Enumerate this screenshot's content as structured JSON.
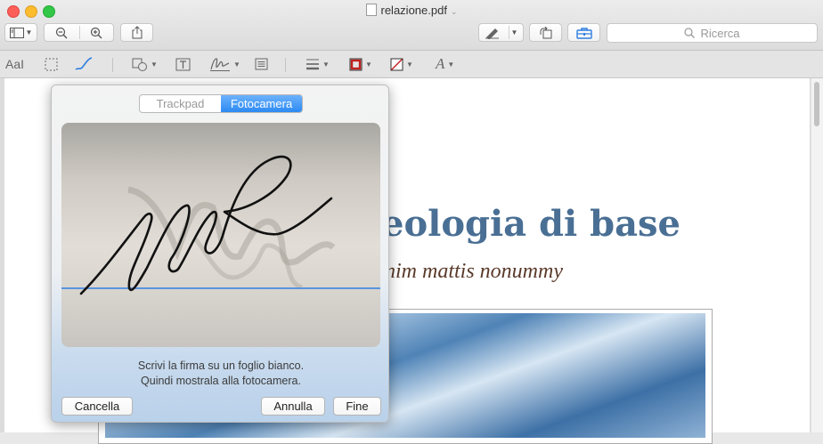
{
  "window": {
    "title": "relazione.pdf"
  },
  "toolbar": {
    "search_placeholder": "Ricerca"
  },
  "markup": {
    "text_style_label": "AaI"
  },
  "document": {
    "heading_partial": "eologia di base",
    "subheading_partial": "nim mattis nonummy"
  },
  "signature_popover": {
    "tabs": [
      {
        "label": "Trackpad",
        "selected": false
      },
      {
        "label": "Fotocamera",
        "selected": true
      }
    ],
    "instruction_line1": "Scrivi la firma su un foglio bianco.",
    "instruction_line2": "Quindi mostrala alla fotocamera.",
    "clear_label": "Cancella",
    "cancel_label": "Annulla",
    "done_label": "Fine"
  },
  "colors": {
    "accent": "#2d8af3",
    "heading": "#4a6f94",
    "subheading": "#5a3a2a",
    "border_color_swatch": "#c0211f",
    "baseline": "#5a95de"
  },
  "icons": [
    "sidebar-icon",
    "zoom-out-icon",
    "zoom-in-icon",
    "share-icon",
    "markup-pen-icon",
    "rotate-icon",
    "toolbox-icon",
    "search-icon",
    "rect-selection-icon",
    "sketch-icon",
    "shapes-icon",
    "text-box-icon",
    "signature-icon",
    "note-icon",
    "line-style-icon",
    "border-color-icon",
    "fill-color-icon",
    "font-icon"
  ]
}
